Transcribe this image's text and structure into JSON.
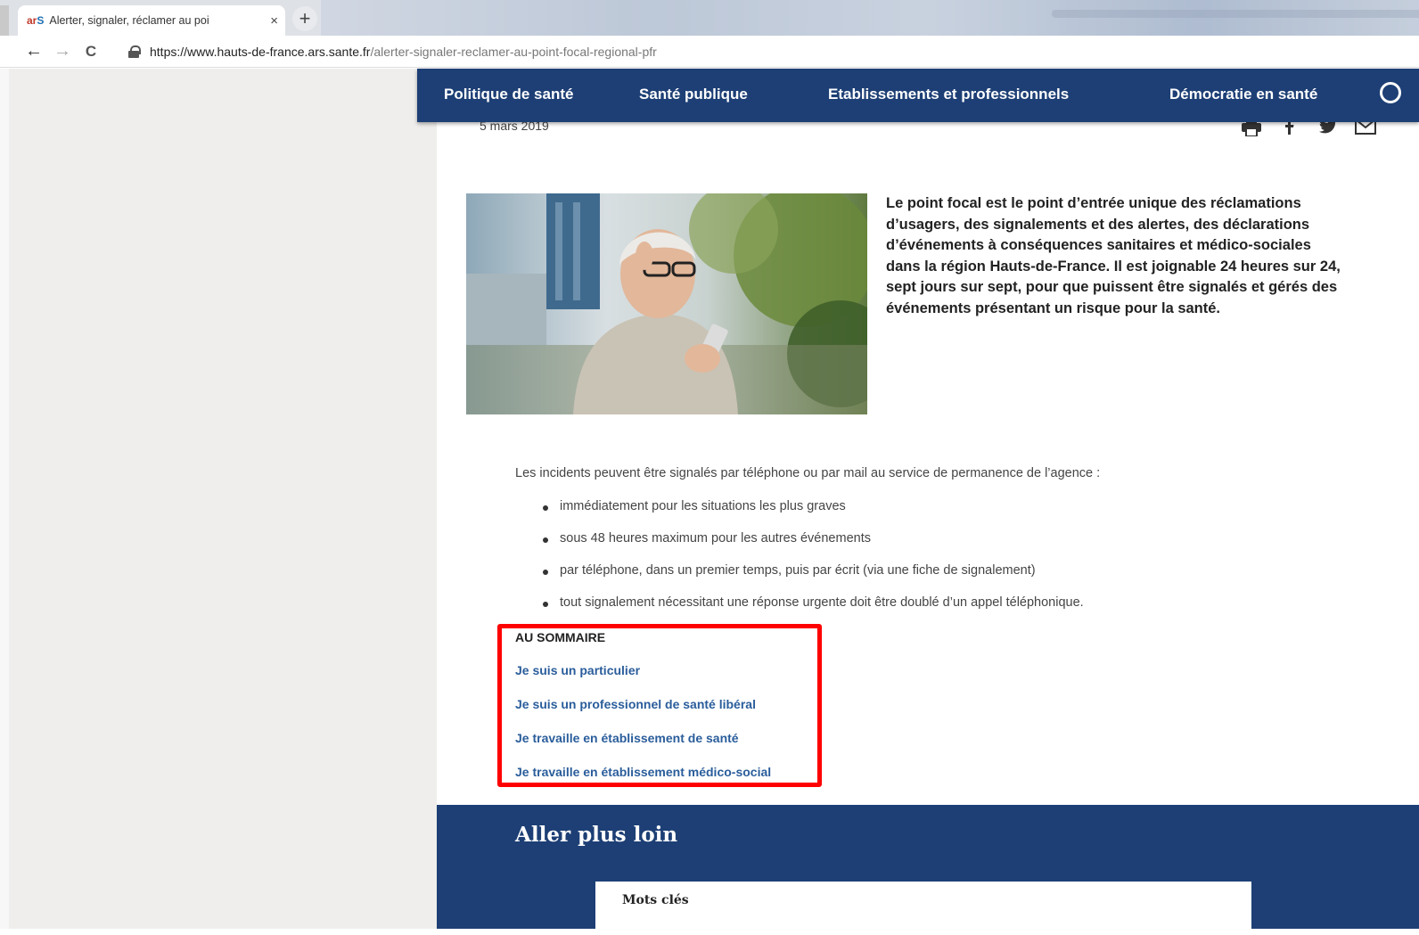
{
  "browser": {
    "tab": {
      "favicon": "ars",
      "title": "Alerter, signaler, réclamer au poi",
      "close": "×"
    },
    "new_tab": "+",
    "nav": {
      "back": "←",
      "forward": "→",
      "reload": "C"
    },
    "url": {
      "host": "https://www.hauts-de-france.ars.sante.fr",
      "path": "/alerter-signaler-reclamer-au-point-focal-regional-pfr"
    }
  },
  "mainnav": {
    "items": [
      "Politique de santé",
      "Santé publique",
      "Etablissements et professionnels",
      "Démocratie en santé"
    ]
  },
  "article": {
    "date": "5 mars 2019",
    "intro": "Le point focal est le point d’entrée unique des réclamations d’usagers, des signalements et des alertes, des déclarations d’événements à conséquences sanitaires et médico-sociales dans la région Hauts-de-France. Il est joignable 24 heures sur 24, sept jours sur sept, pour que puissent être signalés et gérés des événements présentant un risque pour la santé.",
    "lead": "Les incidents peuvent être signalés par téléphone ou par mail au service de permanence de l’agence :",
    "bullets": [
      "immédiatement pour les situations les plus graves",
      "sous 48 heures maximum pour les autres événements",
      "par téléphone, dans un premier temps, puis par écrit (via une fiche de signalement)",
      "tout signalement nécessitant une réponse urgente doit être doublé d’un appel téléphonique."
    ]
  },
  "sommaire": {
    "title": "AU SOMMAIRE",
    "links": [
      "Je suis un particulier",
      "Je suis un professionnel de santé libéral",
      "Je travaille en établissement de santé",
      "Je travaille en établissement médico-social"
    ]
  },
  "aller_plus_loin": {
    "title": "Aller plus loin",
    "tags_label": "Mots clés"
  },
  "share_icons": [
    "print-icon",
    "facebook-icon",
    "twitter-icon",
    "mail-icon"
  ],
  "colors": {
    "nav_bg": "#1d3f75",
    "link": "#2a5d9b",
    "highlight": "#ff0000"
  }
}
